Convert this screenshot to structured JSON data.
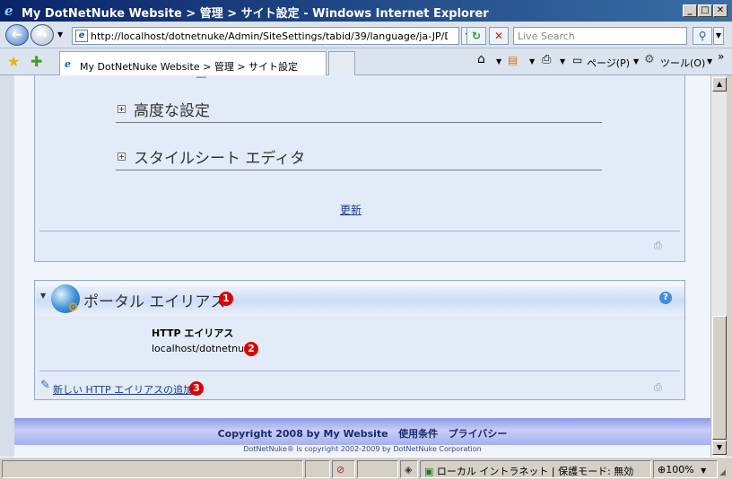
{
  "window": {
    "title": "My DotNetNuke Website > 管理 > サイト設定 - Windows Internet Explorer",
    "minimize": "_",
    "maximize": "□",
    "close": "✕"
  },
  "nav": {
    "back_icon": "back-arrow-icon",
    "forward_icon": "forward-arrow-icon",
    "address": "http://localhost/dotnetnuke/Admin/SiteSettings/tabid/39/language/ja-JP/D",
    "search_placeholder": "Live Search"
  },
  "tabs": {
    "active_tab": "My DotNetNuke Website > 管理 > サイト設定"
  },
  "commands": {
    "page": "ページ(P)",
    "tools": "ツール(O)"
  },
  "settings_panel": {
    "advanced": "高度な設定",
    "stylesheet_editor": "スタイルシート エディタ",
    "update_link": "更新"
  },
  "portal_alias": {
    "title": "ポータル エイリアス",
    "callout1": "1",
    "column_header": "HTTP エイリアス",
    "alias_value": "localhost/dotnetnuke",
    "callout2": "2",
    "add_link": "新しい HTTP エイリアスの追加",
    "callout3": "3"
  },
  "footer": {
    "copyright": "Copyright 2008 by My Website",
    "terms": "使用条件",
    "privacy": "プライバシー",
    "dnn_copyright": "DotNetNuke® is copyright 2002-2009 by DotNetNuke Corporation"
  },
  "status": {
    "zone": "ローカル イントラネット | 保護モード: 無効",
    "zoom": "100%"
  },
  "colors": {
    "accent": "#e00000",
    "link": "#1a3c8c"
  }
}
